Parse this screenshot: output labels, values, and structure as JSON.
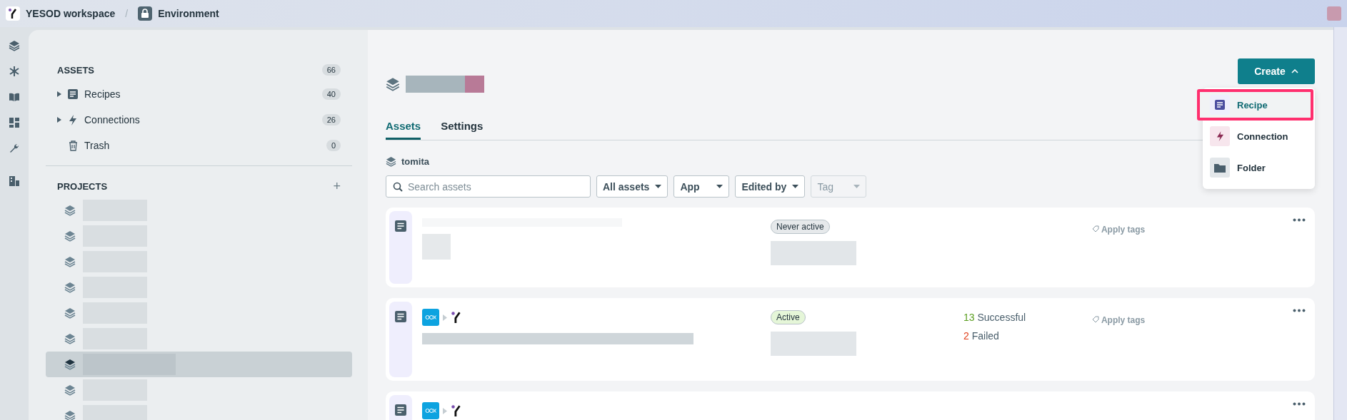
{
  "topbar": {
    "workspace": "YESOD workspace",
    "separator": "/",
    "environment": "Environment"
  },
  "sidebar": {
    "assets_title": "ASSETS",
    "assets_count": "66",
    "items": [
      {
        "label": "Recipes",
        "count": "40",
        "expandable": true
      },
      {
        "label": "Connections",
        "count": "26",
        "expandable": true
      },
      {
        "label": "Trash",
        "count": "0",
        "expandable": false
      }
    ],
    "projects_title": "PROJECTS",
    "add": "+",
    "projects": [
      {
        "selected": false
      },
      {
        "selected": false
      },
      {
        "selected": false
      },
      {
        "selected": false
      },
      {
        "selected": false
      },
      {
        "selected": false
      },
      {
        "selected": true
      },
      {
        "selected": false
      },
      {
        "selected": false
      }
    ]
  },
  "create": {
    "label": "Create",
    "menu": [
      {
        "label": "Recipe",
        "highlighted": true
      },
      {
        "label": "Connection",
        "highlighted": false
      },
      {
        "label": "Folder",
        "highlighted": false
      }
    ]
  },
  "tabs": [
    {
      "label": "Assets",
      "selected": true
    },
    {
      "label": "Settings",
      "selected": false
    }
  ],
  "folder": "tomita",
  "search": {
    "placeholder": "Search assets"
  },
  "filters": [
    {
      "label": "All assets",
      "disabled": false
    },
    {
      "label": "App",
      "disabled": false
    },
    {
      "label": "Edited by",
      "disabled": false
    },
    {
      "label": "Tag",
      "disabled": true
    }
  ],
  "rows": [
    {
      "connectors": false,
      "status": "Never active",
      "color": "#e6e9eb",
      "tags": "Apply tags"
    },
    {
      "connectors": true,
      "status": "Active",
      "color": "#e5f6d8",
      "successful_count": "13",
      "successful": "Successful",
      "failed_count": "2",
      "failed": "Failed",
      "tags": "Apply tags"
    },
    {
      "connectors": true
    }
  ]
}
